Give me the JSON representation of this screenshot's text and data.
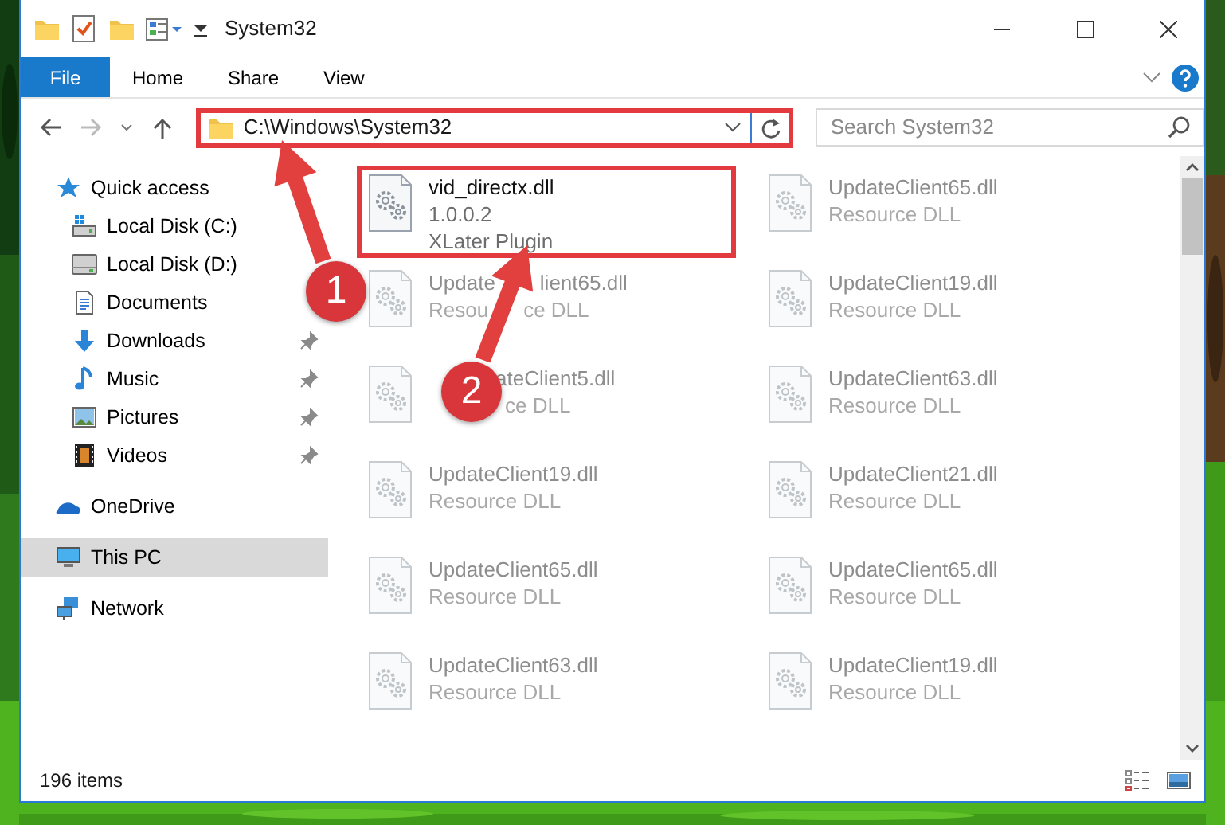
{
  "window": {
    "title": "System32"
  },
  "ribbon_tabs": [
    {
      "label": "File",
      "kind": "file"
    },
    {
      "label": "Home",
      "kind": "tab"
    },
    {
      "label": "Share",
      "kind": "tab"
    },
    {
      "label": "View",
      "kind": "tab"
    }
  ],
  "address_bar": {
    "path": "C:\\Windows\\System32",
    "highlighted": true
  },
  "search": {
    "placeholder": "Search System32"
  },
  "navigation": [
    {
      "label": "Quick access",
      "selected": false,
      "pinned": false,
      "children": [
        {
          "label": "Local Disk (C:)",
          "selected": false,
          "pinned": false
        },
        {
          "label": "Local Disk (D:)",
          "selected": false,
          "pinned": false
        },
        {
          "label": "Documents",
          "selected": false,
          "pinned": false
        },
        {
          "label": "Downloads",
          "selected": false,
          "pinned": true
        },
        {
          "label": "Music",
          "selected": false,
          "pinned": true
        },
        {
          "label": "Pictures",
          "selected": false,
          "pinned": true
        },
        {
          "label": "Videos",
          "selected": false,
          "pinned": true
        }
      ]
    },
    {
      "label": "OneDrive",
      "selected": false,
      "pinned": false
    },
    {
      "label": "This PC",
      "selected": true,
      "pinned": false
    },
    {
      "label": "Network",
      "selected": false,
      "pinned": false
    }
  ],
  "files": [
    {
      "name": [
        "vid_directx.dll"
      ],
      "details": [
        [
          "1.0.0.2"
        ],
        [
          "XLater Plugin"
        ]
      ],
      "highlighted": true,
      "blurred": false
    },
    {
      "name": [
        "UpdateClient65.dll"
      ],
      "details": [
        [
          "Resource DLL"
        ]
      ],
      "highlighted": false,
      "blurred": true
    },
    {
      "name": [
        "Update",
        "lient65.dll"
      ],
      "details": [
        [
          "Resou",
          "ce DLL"
        ]
      ],
      "highlighted": false,
      "blurred": true
    },
    {
      "name": [
        "UpdateClient19.dll"
      ],
      "details": [
        [
          "Resource DLL"
        ]
      ],
      "highlighted": false,
      "blurred": true
    },
    {
      "name": [
        "ateClient5.dll"
      ],
      "details": [
        [
          "ce DLL"
        ]
      ],
      "highlighted": false,
      "blurred": true
    },
    {
      "name": [
        "UpdateClient63.dll"
      ],
      "details": [
        [
          "Resource DLL"
        ]
      ],
      "highlighted": false,
      "blurred": true
    },
    {
      "name": [
        "UpdateClient19.dll"
      ],
      "details": [
        [
          "Resource DLL"
        ]
      ],
      "highlighted": false,
      "blurred": true
    },
    {
      "name": [
        "UpdateClient21.dll"
      ],
      "details": [
        [
          "Resource DLL"
        ]
      ],
      "highlighted": false,
      "blurred": true
    },
    {
      "name": [
        "UpdateClient65.dll"
      ],
      "details": [
        [
          "Resource DLL"
        ]
      ],
      "highlighted": false,
      "blurred": true
    },
    {
      "name": [
        "UpdateClient65.dll"
      ],
      "details": [
        [
          "Resource DLL"
        ]
      ],
      "highlighted": false,
      "blurred": true
    },
    {
      "name": [
        "UpdateClient63.dll"
      ],
      "details": [
        [
          "Resource DLL"
        ]
      ],
      "highlighted": false,
      "blurred": true
    },
    {
      "name": [
        "UpdateClient19.dll"
      ],
      "details": [
        [
          "Resource DLL"
        ]
      ],
      "highlighted": false,
      "blurred": true
    }
  ],
  "status_bar": {
    "item_count": "196 items"
  },
  "annotations": [
    {
      "number": "1"
    },
    {
      "number": "2"
    }
  ]
}
